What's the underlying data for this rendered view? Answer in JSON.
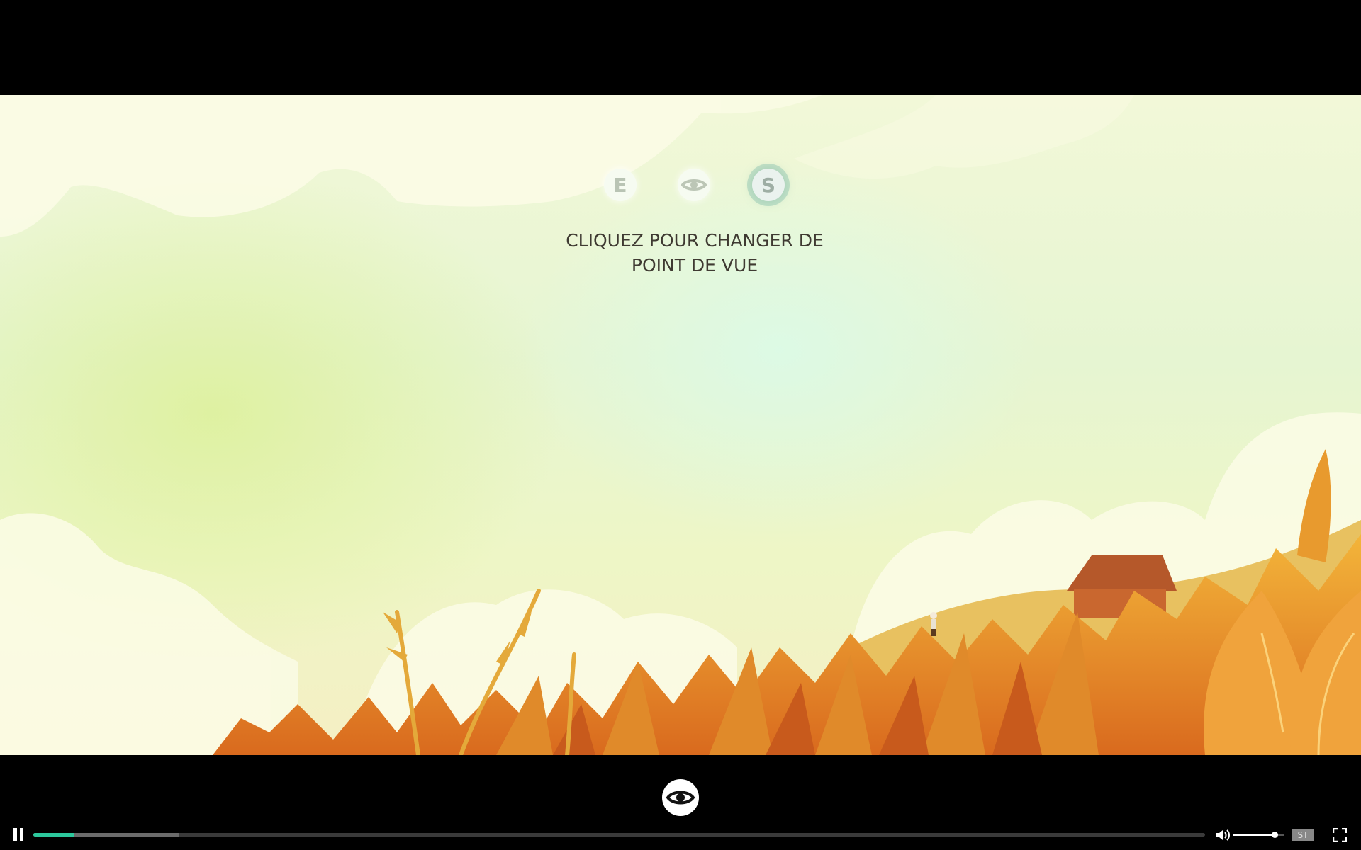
{
  "pov_switcher": {
    "buttons": [
      {
        "name": "E",
        "label": "E",
        "active": false
      },
      {
        "name": "eye",
        "icon": "eye-icon",
        "active": false
      },
      {
        "name": "S",
        "label": "S",
        "active": true
      }
    ],
    "caption_line1": "CLIQUEZ POUR CHANGER DE",
    "caption_line2": "POINT DE VUE"
  },
  "player": {
    "center_button_icon": "eye-icon",
    "pause_icon": "pause-icon",
    "progress_played": 0.035,
    "progress_buffered": 0.124,
    "progress_color": "#2cc89c",
    "volume_icon": "speaker-icon",
    "volume_level": 0.8,
    "subtitles_label": "ST",
    "fullscreen_icon": "fullscreen-icon"
  }
}
